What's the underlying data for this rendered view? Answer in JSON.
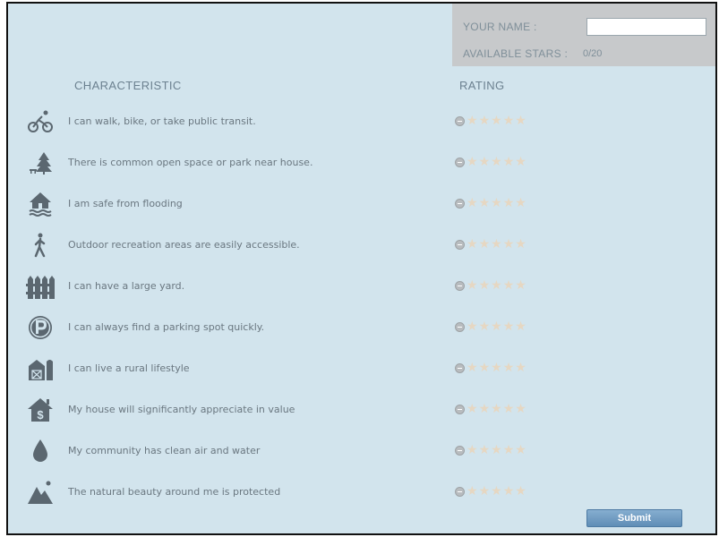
{
  "form": {
    "name_label": "YOUR NAME :",
    "name_value": "",
    "stars_label": "AVAILABLE STARS :",
    "stars_value": "0/20"
  },
  "columns": {
    "characteristic": "CHARACTERISTIC",
    "rating": "RATING"
  },
  "rows": [
    {
      "icon": "bicycle-icon",
      "text": "I can walk, bike, or take public transit.",
      "rating": 0,
      "max": 5
    },
    {
      "icon": "park-tree-icon",
      "text": "There is common open space or park near house.",
      "rating": 0,
      "max": 5
    },
    {
      "icon": "flood-house-icon",
      "text": "I am safe from flooding",
      "rating": 0,
      "max": 5
    },
    {
      "icon": "hiker-icon",
      "text": "Outdoor recreation areas are easily accessible.",
      "rating": 0,
      "max": 5
    },
    {
      "icon": "fence-icon",
      "text": "I can have a large yard.",
      "rating": 0,
      "max": 5
    },
    {
      "icon": "parking-icon",
      "text": "I can always find a parking spot quickly.",
      "rating": 0,
      "max": 5
    },
    {
      "icon": "barn-icon",
      "text": "I can live a rural lifestyle",
      "rating": 0,
      "max": 5
    },
    {
      "icon": "house-dollar-icon",
      "text": "My house will significantly appreciate in value",
      "rating": 0,
      "max": 5
    },
    {
      "icon": "water-drop-icon",
      "text": "My community has clean air and water",
      "rating": 0,
      "max": 5
    },
    {
      "icon": "mountain-icon",
      "text": "The natural beauty around me is protected",
      "rating": 0,
      "max": 5
    }
  ],
  "submit_label": "Submit",
  "colors": {
    "background": "#d2e4ed",
    "panel": "#c7c9cb",
    "icon": "#5b6770",
    "star_empty": "#e6d7c2",
    "button": "#6d9ac2"
  }
}
